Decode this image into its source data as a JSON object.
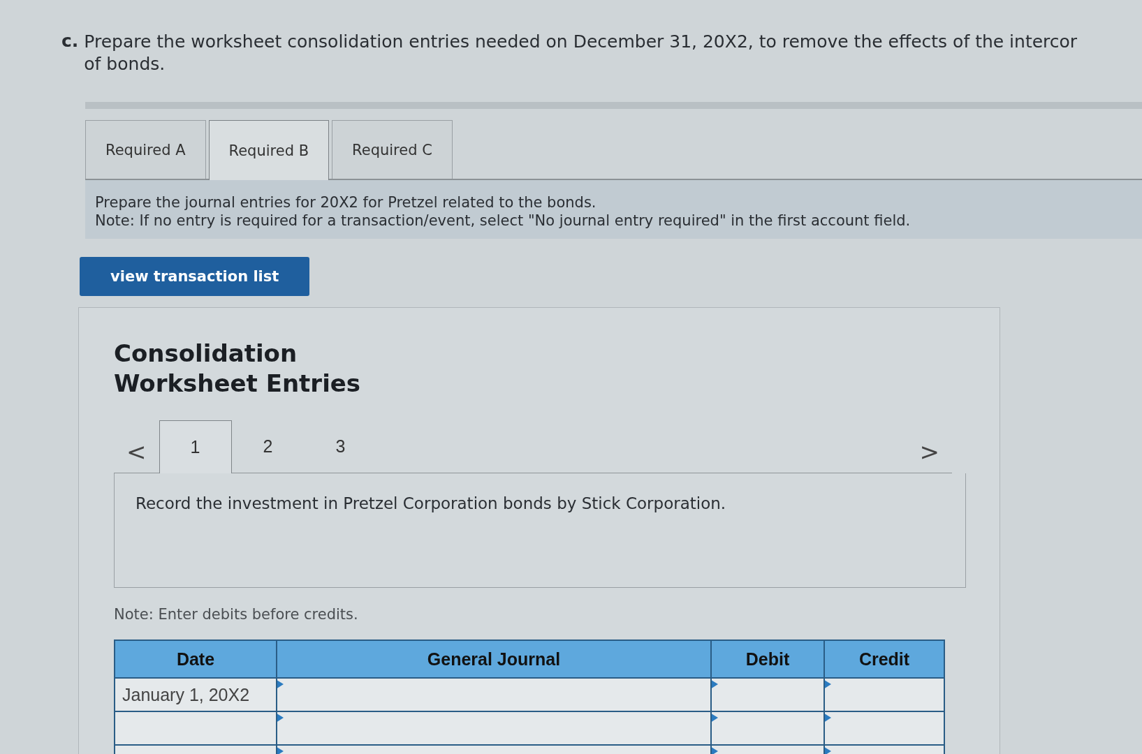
{
  "question": {
    "letter": "c.",
    "text": "Prepare the worksheet consolidation entries needed on December 31, 20X2, to remove the effects of the intercor",
    "text_line2": "of bonds."
  },
  "tabs": [
    {
      "label": "Required A",
      "selected": false
    },
    {
      "label": "Required B",
      "selected": true
    },
    {
      "label": "Required C",
      "selected": false
    }
  ],
  "instructions": [
    "Prepare the journal entries for 20X2 for Pretzel related to the bonds.",
    "Note: If no entry is required for a transaction/event, select \"No journal entry required\" in the first account field."
  ],
  "view_button": "view transaction list",
  "panel": {
    "title": "Consolidation Worksheet Entries",
    "pages": [
      {
        "label": "1",
        "selected": true
      },
      {
        "label": "2",
        "selected": false
      },
      {
        "label": "3",
        "selected": false
      }
    ],
    "prev": "<",
    "next": ">",
    "description": "Record the investment in Pretzel Corporation bonds by Stick Corporation.",
    "note": "Note: Enter debits before credits.",
    "table": {
      "columns": [
        "Date",
        "General Journal",
        "Debit",
        "Credit"
      ],
      "rows": [
        {
          "date": "January 1, 20X2"
        },
        {
          "date": ""
        },
        {
          "date": ""
        }
      ]
    }
  }
}
